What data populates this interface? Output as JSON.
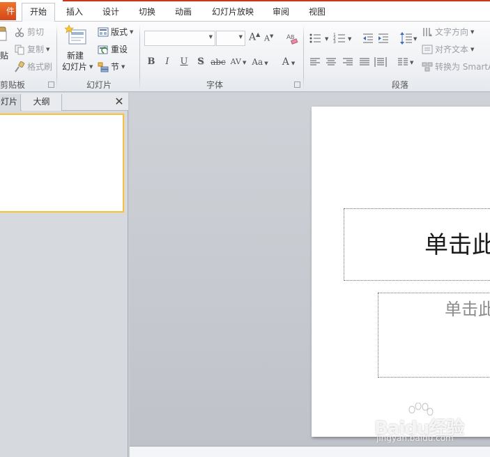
{
  "tabs": {
    "file": "件",
    "home": "开始",
    "insert": "插入",
    "design": "设计",
    "transitions": "切换",
    "animations": "动画",
    "slideshow": "幻灯片放映",
    "review": "审阅",
    "view": "视图"
  },
  "ribbon": {
    "clipboard": {
      "label": "剪贴板",
      "paste": "贴",
      "cut": "剪切",
      "copy": "复制",
      "format_painter": "格式刷"
    },
    "slides": {
      "label": "幻灯片",
      "new_slide_line1": "新建",
      "new_slide_line2": "幻灯片",
      "layout": "版式",
      "reset": "重设",
      "section": "节"
    },
    "font": {
      "label": "字体",
      "font_name_value": "",
      "font_size_value": "",
      "bold": "B",
      "italic": "I",
      "underline": "U",
      "shadow": "S",
      "strikethrough": "abc",
      "char_spacing": "AV",
      "change_case": "Aa",
      "font_color": "A",
      "grow": "A",
      "shrink": "A"
    },
    "paragraph": {
      "label": "段落",
      "text_direction": "文字方向",
      "align_text": "对齐文本",
      "convert_smartart": "转换为 SmartA"
    }
  },
  "left_panel": {
    "tab_slides": "灯片",
    "tab_outline": "大纲",
    "close": "✕"
  },
  "slide": {
    "title_placeholder": "单击此",
    "subtitle_placeholder": "单击此"
  },
  "notes": {
    "placeholder": ""
  },
  "watermark": {
    "brand": "Baidu经验",
    "url": "jingyan.baidu.com"
  },
  "colors": {
    "file_tab": "#d4461b",
    "accent_line": "#c8381c",
    "selected_thumb_border": "#f2c24f"
  }
}
